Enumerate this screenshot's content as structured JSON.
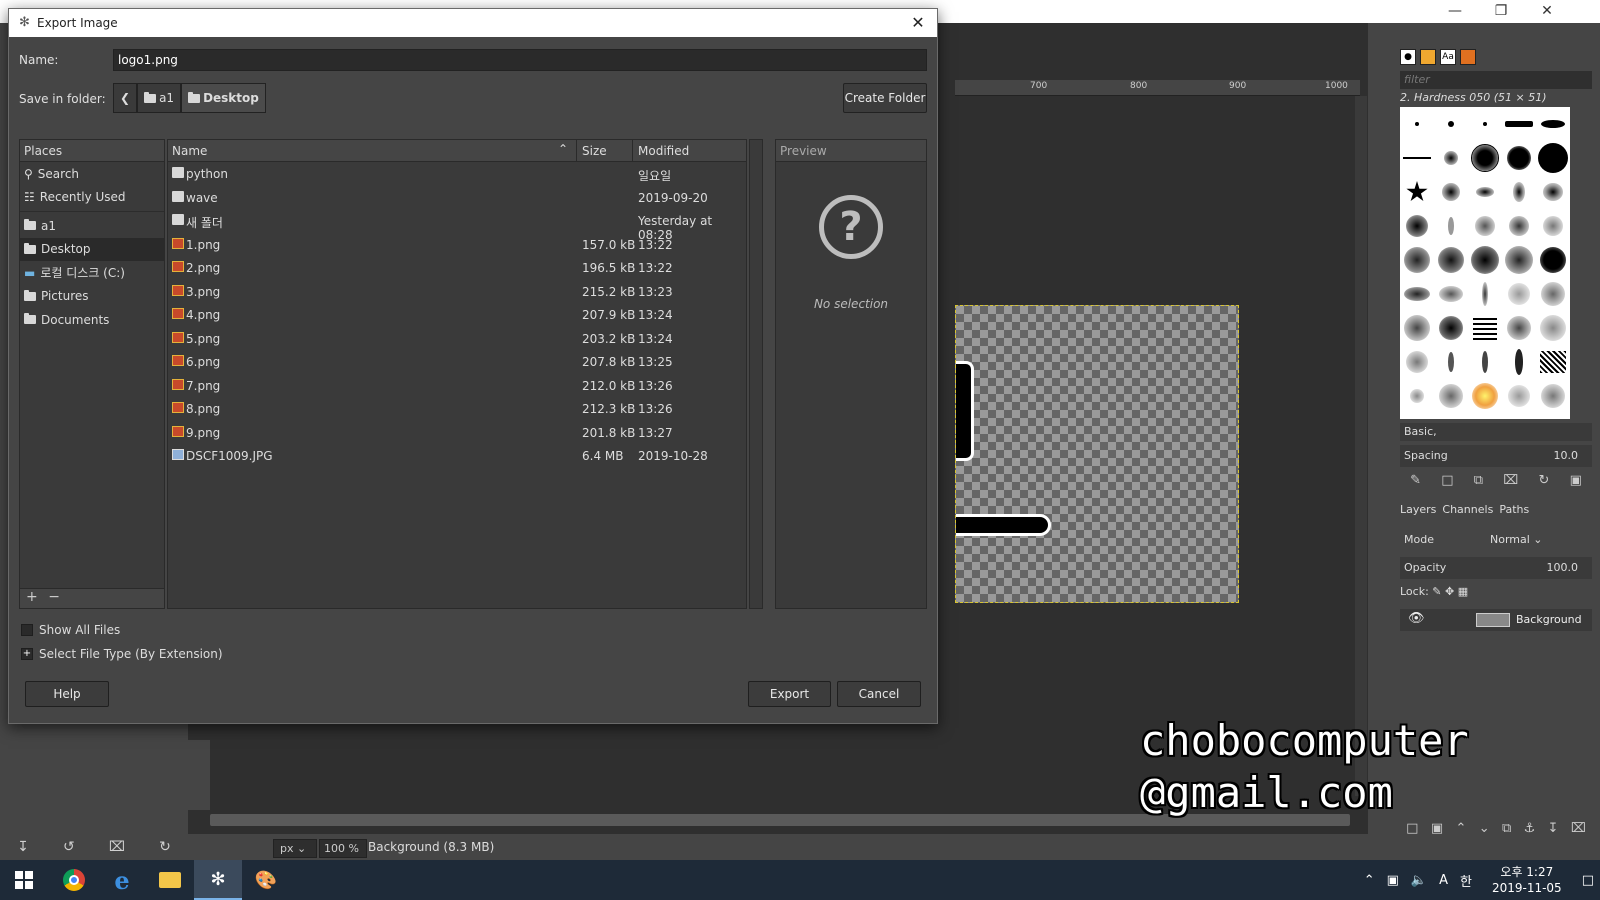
{
  "dialog": {
    "title": "Export Image",
    "name_label": "Name:",
    "filename": "logo1.png",
    "save_in_label": "Save in folder:",
    "path": [
      "a1",
      "Desktop"
    ],
    "create_folder": "Create Folder",
    "places": {
      "header": "Places",
      "items": [
        {
          "label": "Search",
          "icon": "search-icon"
        },
        {
          "label": "Recently Used",
          "icon": "recent-icon"
        },
        {
          "label": "a1",
          "icon": "folder-icon"
        },
        {
          "label": "Desktop",
          "icon": "folder-icon"
        },
        {
          "label": "로컬 디스크 (C:)",
          "icon": "drive-icon"
        },
        {
          "label": "Pictures",
          "icon": "folder-icon"
        },
        {
          "label": "Documents",
          "icon": "folder-icon"
        }
      ],
      "selected": "Desktop"
    },
    "files": {
      "columns": [
        "Name",
        "Size",
        "Modified"
      ],
      "rows": [
        {
          "name": "python",
          "size": "",
          "modified": "일요일",
          "type": "folder"
        },
        {
          "name": "wave",
          "size": "",
          "modified": "2019-09-20",
          "type": "folder"
        },
        {
          "name": "새 폴더",
          "size": "",
          "modified": "Yesterday at 08:28",
          "type": "folder"
        },
        {
          "name": "1.png",
          "size": "157.0 kB",
          "modified": "13:22",
          "type": "png"
        },
        {
          "name": "2.png",
          "size": "196.5 kB",
          "modified": "13:22",
          "type": "png"
        },
        {
          "name": "3.png",
          "size": "215.2 kB",
          "modified": "13:23",
          "type": "png"
        },
        {
          "name": "4.png",
          "size": "207.9 kB",
          "modified": "13:24",
          "type": "png"
        },
        {
          "name": "5.png",
          "size": "203.2 kB",
          "modified": "13:24",
          "type": "png"
        },
        {
          "name": "6.png",
          "size": "207.8 kB",
          "modified": "13:25",
          "type": "png"
        },
        {
          "name": "7.png",
          "size": "212.0 kB",
          "modified": "13:26",
          "type": "png"
        },
        {
          "name": "8.png",
          "size": "212.3 kB",
          "modified": "13:26",
          "type": "png"
        },
        {
          "name": "9.png",
          "size": "201.8 kB",
          "modified": "13:27",
          "type": "png"
        },
        {
          "name": "DSCF1009.JPG",
          "size": "6.4 MB",
          "modified": "2019-10-28",
          "type": "jpg"
        }
      ]
    },
    "preview": {
      "header": "Preview",
      "empty_text": "No selection"
    },
    "show_all_files": "Show All Files",
    "select_file_type": "Select File Type (By Extension)",
    "help": "Help",
    "export": "Export",
    "cancel": "Cancel"
  },
  "gimp": {
    "ruler_ticks": [
      "700",
      "800",
      "900",
      "1000"
    ],
    "unit": "px",
    "zoom": "100 %",
    "status": "Background (8.3 MB)",
    "brushes": {
      "filter_placeholder": "filter",
      "current": "2. Hardness 050 (51 × 51)",
      "preset": "Basic,",
      "spacing_label": "Spacing",
      "spacing_value": "10.0"
    },
    "layers": {
      "tabs": [
        "Layers",
        "Channels",
        "Paths"
      ],
      "mode_label": "Mode",
      "mode_value": "Normal",
      "opacity_label": "Opacity",
      "opacity_value": "100.0",
      "lock_label": "Lock:",
      "layer_name": "Background"
    }
  },
  "watermark": [
    "chobocomputer",
    "@gmail.com"
  ],
  "taskbar": {
    "time": "오후 1:27",
    "date": "2019-11-05",
    "ime": "A",
    "lang": "한"
  }
}
